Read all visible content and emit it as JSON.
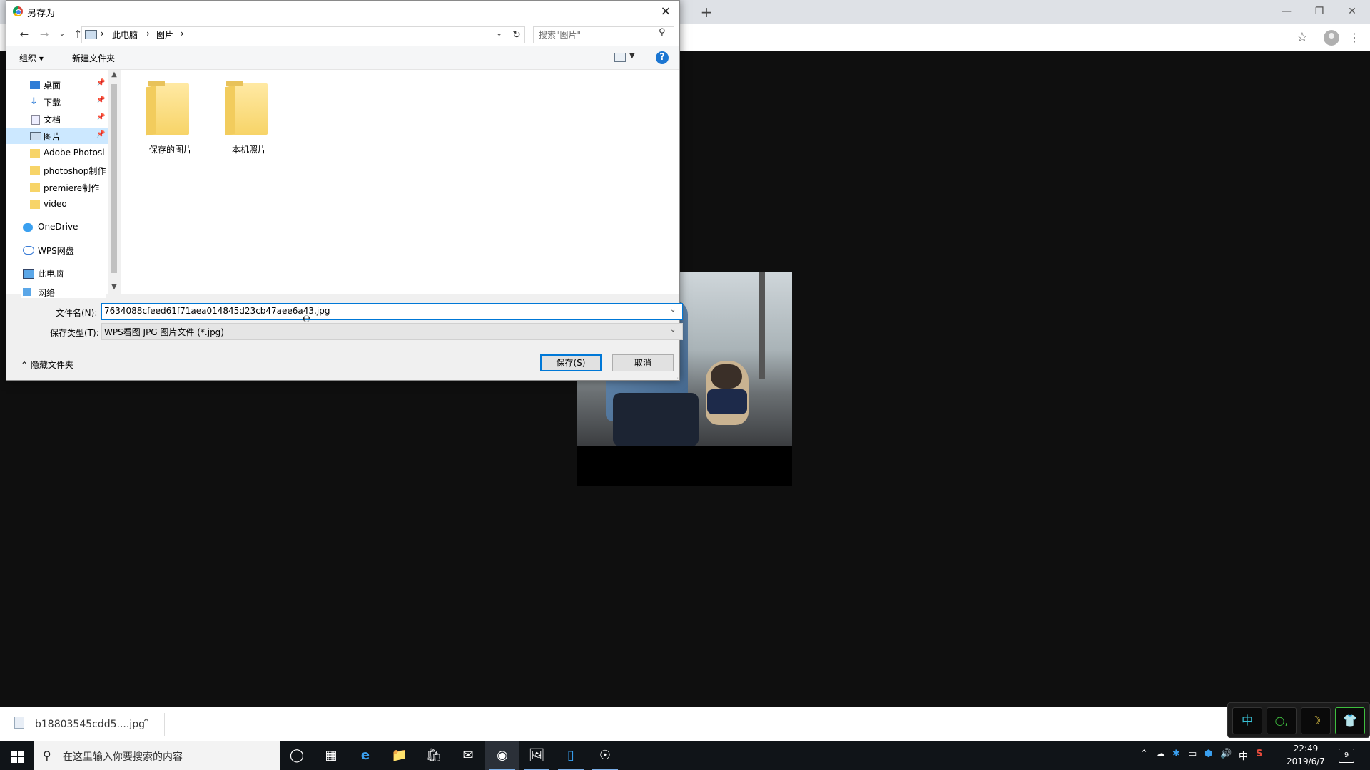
{
  "browser": {
    "new_tab_icon": "+",
    "window_controls": [
      "minimize-icon",
      "restore-icon",
      "close-icon"
    ],
    "bookmark_icon": "star-icon",
    "menu_icon": "kebab-icon"
  },
  "download_bar": {
    "file_name": "b18803545cdd5....jpg"
  },
  "dialog": {
    "title": "另存为",
    "close_icon": "×",
    "breadcrumb": [
      "此电脑",
      "图片"
    ],
    "search_placeholder": "搜索\"图片\"",
    "toolbar": {
      "organize_label": "组织 ▾",
      "new_folder_label": "新建文件夹"
    },
    "nav_items": [
      {
        "label": "桌面",
        "icon": "desktop-icon",
        "pinned": true,
        "selected": false
      },
      {
        "label": "下载",
        "icon": "download-icon",
        "pinned": true,
        "selected": false
      },
      {
        "label": "文档",
        "icon": "document-icon",
        "pinned": true,
        "selected": false
      },
      {
        "label": "图片",
        "icon": "pictures-icon",
        "pinned": true,
        "selected": true
      },
      {
        "label": "Adobe Photosl",
        "icon": "folder-icon",
        "pinned": false,
        "selected": false
      },
      {
        "label": "photoshop制作",
        "icon": "folder-icon",
        "pinned": false,
        "selected": false
      },
      {
        "label": "premiere制作",
        "icon": "folder-icon",
        "pinned": false,
        "selected": false
      },
      {
        "label": "video",
        "icon": "folder-icon",
        "pinned": false,
        "selected": false
      },
      {
        "label": "OneDrive",
        "icon": "onedrive-icon",
        "pinned": false,
        "selected": false
      },
      {
        "label": "WPS网盘",
        "icon": "cloud-icon",
        "pinned": false,
        "selected": false
      },
      {
        "label": "此电脑",
        "icon": "computer-icon",
        "pinned": false,
        "selected": false
      },
      {
        "label": "网络",
        "icon": "network-icon",
        "pinned": false,
        "selected": false
      }
    ],
    "folders": [
      "保存的图片",
      "本机照片"
    ],
    "filename_label": "文件名(N):",
    "filename_value": "7634088cfeed61f71aea014845d23cb47aee6a43.jpg",
    "filetype_label": "保存类型(T):",
    "filetype_value": "WPS看图 JPG 图片文件 (*.jpg)",
    "hide_folders_label": "隐藏文件夹",
    "save_label": "保存(S)",
    "cancel_label": "取消"
  },
  "ime_panel": [
    "中",
    "○,",
    "☽",
    "👕"
  ],
  "taskbar": {
    "search_placeholder": "在这里输入你要搜索的内容",
    "ime_label": "中",
    "time": "22:49",
    "date": "2019/6/7",
    "notification_count": "9"
  },
  "colors": {
    "accent": "#0078d7",
    "selected_bg": "#cce8ff",
    "page_bg": "#0f0f0f"
  }
}
